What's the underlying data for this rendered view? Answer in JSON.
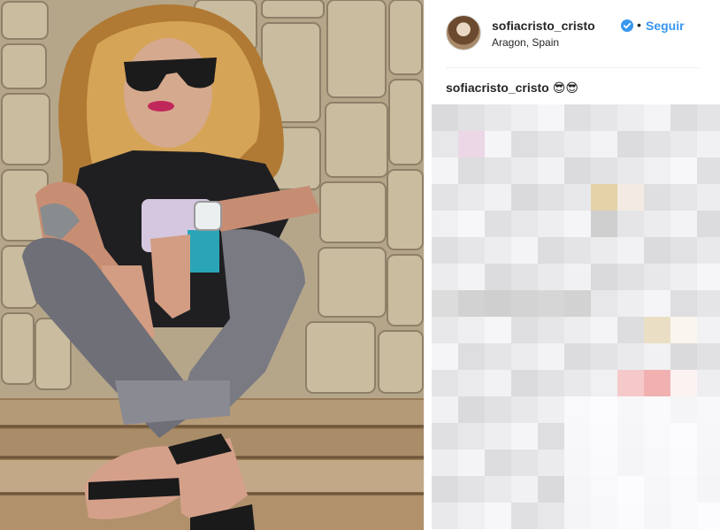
{
  "post": {
    "author": {
      "username": "sofiacristo_cristo",
      "verified": true,
      "location": "Aragon, Spain"
    },
    "follow_label": "Seguir",
    "separator": "•",
    "caption": {
      "username": "sofiacristo_cristo",
      "text": "😎😎"
    }
  },
  "colors": {
    "accent": "#3897f0",
    "text": "#262626",
    "divider": "#efefef"
  },
  "icons": [
    "verified-badge-icon"
  ]
}
